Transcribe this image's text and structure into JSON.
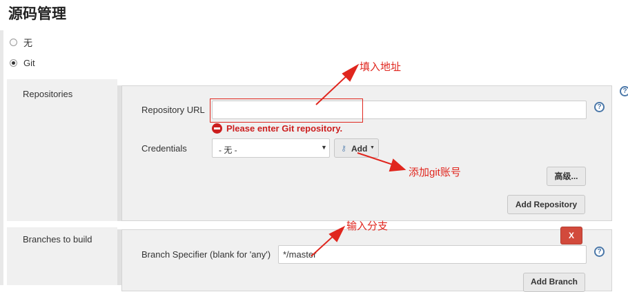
{
  "section": {
    "title": "源码管理"
  },
  "scm_options": [
    {
      "label": "无",
      "selected": false
    },
    {
      "label": "Git",
      "selected": true
    }
  ],
  "repositories": {
    "label": "Repositories",
    "url_label": "Repository URL",
    "url_value": "",
    "error_text": "Please enter Git repository.",
    "credentials_label": "Credentials",
    "credentials_selected": "- 无 -",
    "add_button_label": "Add",
    "advanced_button_label": "高级...",
    "add_repository_label": "Add Repository"
  },
  "branches": {
    "label": "Branches to build",
    "delete_label": "X",
    "specifier_label": "Branch Specifier (blank for 'any')",
    "specifier_value": "*/master",
    "add_branch_label": "Add Branch"
  },
  "help_glyph": "?",
  "annotations": {
    "fill_address": "填入地址",
    "add_git_account": "添加git账号",
    "enter_branch": "输入分支",
    "color": "#e0261e"
  }
}
